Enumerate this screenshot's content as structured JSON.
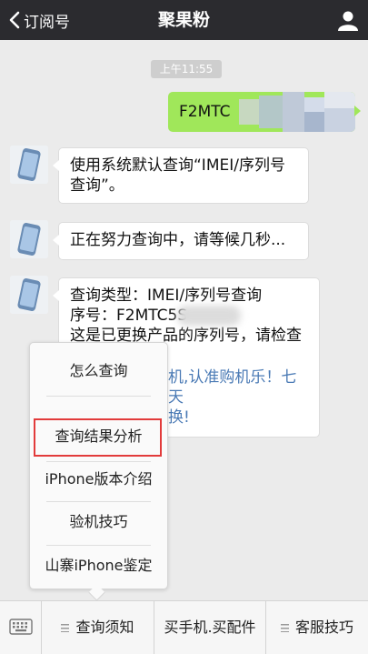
{
  "header": {
    "back_label": "订阅号",
    "title": "聚果粉"
  },
  "chat": {
    "timestamp": "上午11:55",
    "outgoing": {
      "text": "F2MTC"
    },
    "messages": [
      {
        "text": "使用系统默认查询“IMEI/序列号查询”。"
      },
      {
        "text": "正在努力查询中，请等候几秒..."
      },
      {
        "line1": "查询类型：IMEI/序列号查询",
        "line2": "序号：F2MTC5S",
        "line3": "这是已更换产品的序列号，请检查您的信息",
        "promo_line1": "机,认准购机乐！七天",
        "promo_line2": "换!"
      }
    ]
  },
  "popup_menu": {
    "items": [
      {
        "label": "怎么查询"
      },
      {
        "label": "查询结果分析"
      },
      {
        "label": "iPhone版本介绍"
      },
      {
        "label": "验机技巧"
      },
      {
        "label": "山寨iPhone鉴定"
      }
    ]
  },
  "footer": {
    "tabs": [
      {
        "label": "查询须知"
      },
      {
        "label": "买手机.买配件"
      },
      {
        "label": "客服技巧"
      }
    ]
  },
  "colors": {
    "header_bg": "#2b2b2f",
    "outgoing_bubble": "#a0e75a",
    "highlight_border": "#e23b3b",
    "link": "#4a7ab5"
  }
}
